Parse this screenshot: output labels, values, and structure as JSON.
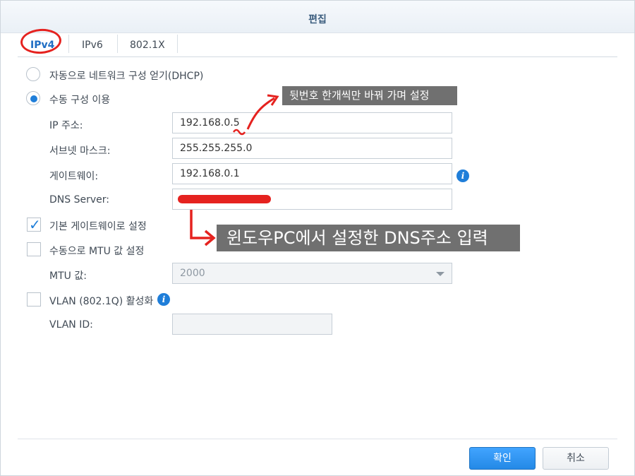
{
  "dialog": {
    "title": "편집"
  },
  "tabs": [
    {
      "label": "IPv4",
      "active": true
    },
    {
      "label": "IPv6",
      "active": false
    },
    {
      "label": "802.1X",
      "active": false
    }
  ],
  "options": {
    "dhcp_label": "자동으로 네트워크 구성 얻기(DHCP)",
    "manual_label": "수동 구성 이용",
    "selected": "manual"
  },
  "fields": {
    "ip": {
      "label": "IP 주소:",
      "value": "192.168.0.5"
    },
    "subnet": {
      "label": "서브넷 마스크:",
      "value": "255.255.255.0"
    },
    "gateway": {
      "label": "게이트웨이:",
      "value": "192.168.0.1"
    },
    "dns": {
      "label": "DNS Server:",
      "value": ""
    },
    "mtu": {
      "label": "MTU 값:",
      "value": "2000"
    },
    "vlan_id": {
      "label": "VLAN ID:",
      "value": ""
    }
  },
  "checkboxes": {
    "default_gateway": {
      "label": "기본 게이트웨이로 설정",
      "checked": true
    },
    "manual_mtu": {
      "label": "수동으로 MTU 값 설정",
      "checked": false
    },
    "vlan": {
      "label": "VLAN (802.1Q) 활성화",
      "checked": false
    }
  },
  "buttons": {
    "ok": "확인",
    "cancel": "취소"
  },
  "annotations": {
    "ip_note": "뒷번호 한개씩만 바꿔 가며 설정",
    "dns_note": "윈도우PC에서 설정한 DNS주소 입력"
  },
  "icons": {
    "info": "info-icon",
    "check": "checkmark-icon",
    "dropdown": "chevron-down-icon"
  },
  "colors": {
    "accent": "#1f7ed9",
    "annotation_red": "#e5221f",
    "note_bg": "#707070"
  }
}
